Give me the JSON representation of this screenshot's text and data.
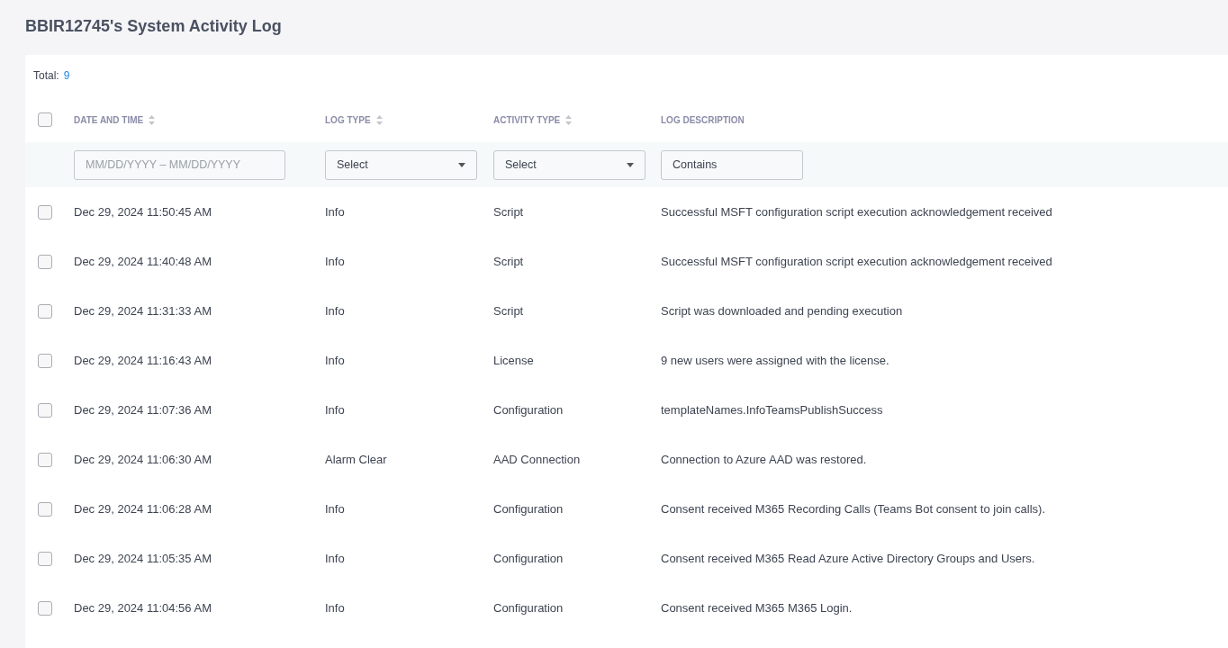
{
  "page_title": "BBIR12745's System Activity Log",
  "total": {
    "label": "Total:",
    "value": "9"
  },
  "table": {
    "select_all": {
      "checked": false
    },
    "columns": [
      {
        "label": "DATE AND TIME",
        "sortable": true
      },
      {
        "label": "LOG TYPE",
        "sortable": true
      },
      {
        "label": "ACTIVITY TYPE",
        "sortable": true
      },
      {
        "label": "LOG DESCRIPTION",
        "sortable": false
      }
    ],
    "filters": [
      {
        "kind": "date",
        "placeholder": "MM/DD/YYYY – MM/DD/YYYY"
      },
      {
        "kind": "select",
        "value": "Select"
      },
      {
        "kind": "select",
        "value": "Select"
      },
      {
        "kind": "text",
        "value": "Contains"
      }
    ],
    "rows": [
      {
        "checked": false,
        "date": "Dec 29, 2024 11:50:45 AM",
        "log_type": "Info",
        "activity_type": "Script",
        "description": "Successful MSFT configuration script execution acknowledgement received"
      },
      {
        "checked": false,
        "date": "Dec 29, 2024 11:40:48 AM",
        "log_type": "Info",
        "activity_type": "Script",
        "description": "Successful MSFT configuration script execution acknowledgement received"
      },
      {
        "checked": false,
        "date": "Dec 29, 2024 11:31:33 AM",
        "log_type": "Info",
        "activity_type": "Script",
        "description": "Script was downloaded and pending execution"
      },
      {
        "checked": false,
        "date": "Dec 29, 2024 11:16:43 AM",
        "log_type": "Info",
        "activity_type": "License",
        "description": "9 new users were assigned with the license."
      },
      {
        "checked": false,
        "date": "Dec 29, 2024 11:07:36 AM",
        "log_type": "Info",
        "activity_type": "Configuration",
        "description": "templateNames.InfoTeamsPublishSuccess"
      },
      {
        "checked": false,
        "date": "Dec 29, 2024 11:06:30 AM",
        "log_type": "Alarm Clear",
        "activity_type": "AAD Connection",
        "description": "Connection to Azure AAD was restored."
      },
      {
        "checked": false,
        "date": "Dec 29, 2024 11:06:28 AM",
        "log_type": "Info",
        "activity_type": "Configuration",
        "description": "Consent received M365 Recording Calls (Teams Bot consent to join calls)."
      },
      {
        "checked": false,
        "date": "Dec 29, 2024 11:05:35 AM",
        "log_type": "Info",
        "activity_type": "Configuration",
        "description": "Consent received M365 Read Azure Active Directory Groups and Users."
      },
      {
        "checked": false,
        "date": "Dec 29, 2024 11:04:56 AM",
        "log_type": "Info",
        "activity_type": "Configuration",
        "description": "Consent received M365 M365 Login."
      }
    ]
  }
}
